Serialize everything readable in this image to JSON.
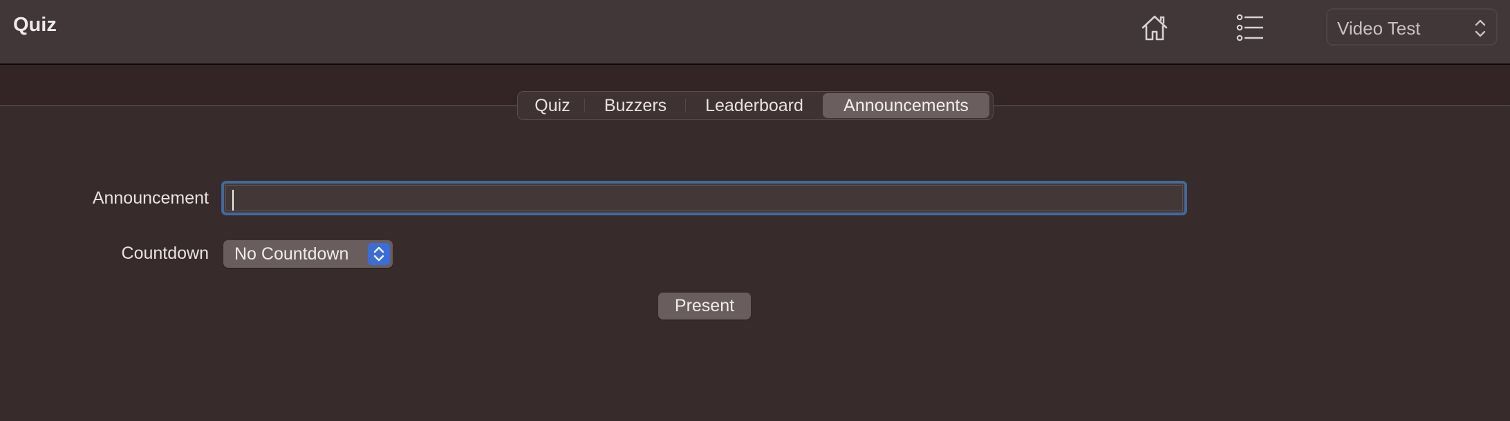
{
  "header": {
    "title": "Quiz",
    "icons": [
      "home-icon",
      "list-icon"
    ],
    "document_selector": {
      "selected": "Video Test"
    }
  },
  "tabs": [
    {
      "label": "Quiz",
      "selected": false
    },
    {
      "label": "Buzzers",
      "selected": false
    },
    {
      "label": "Leaderboard",
      "selected": false
    },
    {
      "label": "Announcements",
      "selected": true
    }
  ],
  "form": {
    "announcement": {
      "label": "Announcement",
      "value": "",
      "focused": true
    },
    "countdown": {
      "label": "Countdown",
      "selected": "No Countdown"
    },
    "present_label": "Present"
  },
  "colors": {
    "focus_ring": "#44699a",
    "accent": "#3a6ed6",
    "selected_tab": "#6a5e5f"
  }
}
